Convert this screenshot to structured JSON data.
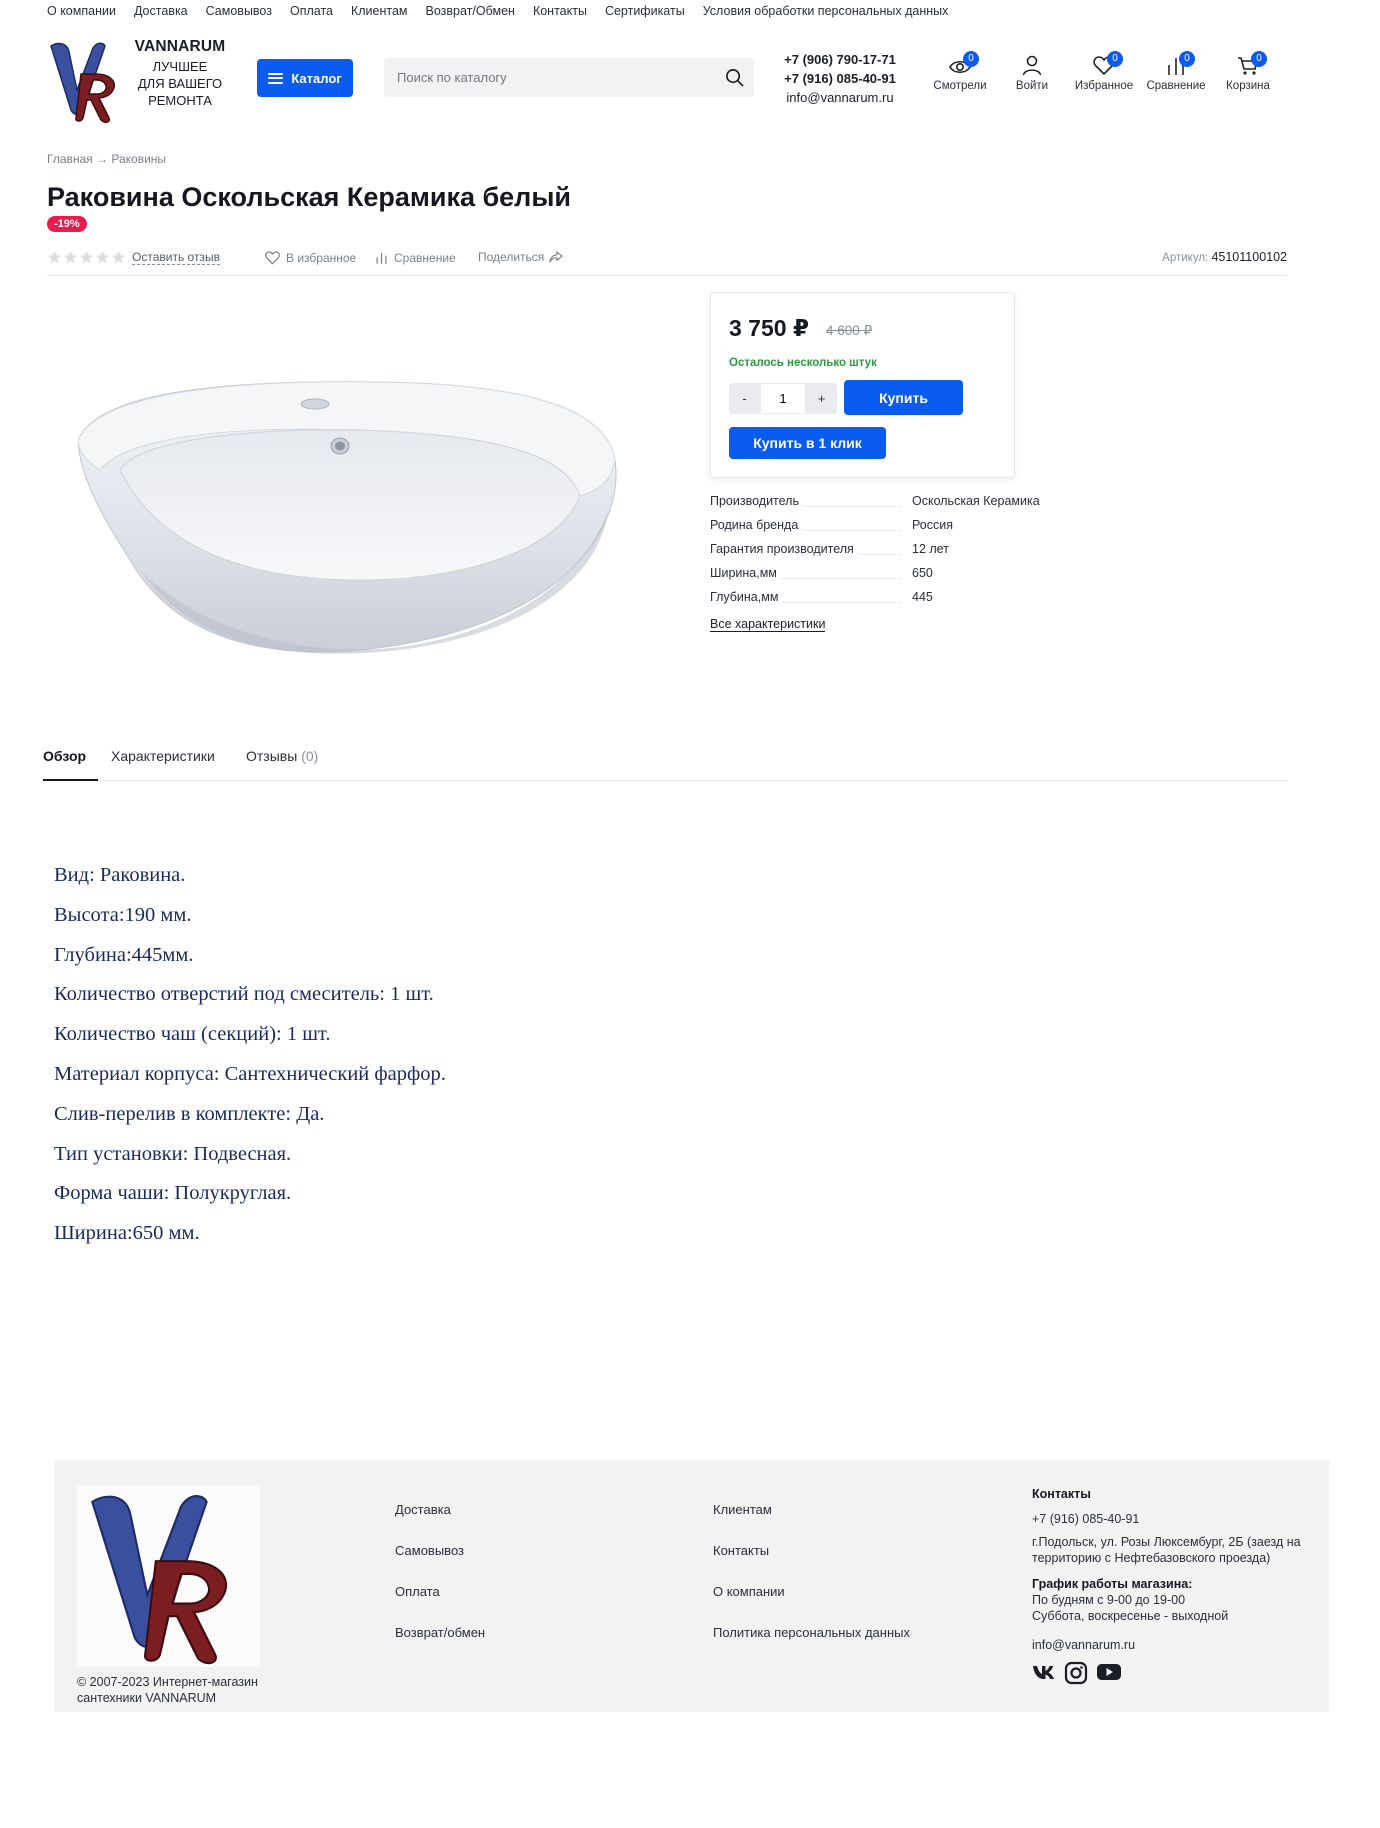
{
  "topnav": [
    "О компании",
    "Доставка",
    "Самовывоз",
    "Оплата",
    "Клиентам",
    "Возврат/Обмен",
    "Контакты",
    "Сертификаты",
    "Условия обработки персональных данных"
  ],
  "brand": {
    "name": "VANNARUM",
    "tagline": [
      "ЛУЧШЕЕ",
      "ДЛЯ ВАШЕГО",
      "РЕМОНТА"
    ],
    "logo_letters": "VR"
  },
  "header": {
    "catalog_label": "Каталог",
    "search_placeholder": "Поиск по каталогу",
    "phone1": "+7 (906) 790-17-71",
    "phone2": "+7 (916) 085-40-91",
    "email": "info@vannarum.ru",
    "icons": [
      {
        "label": "Смотрели",
        "count": "0",
        "icon": "eye-icon"
      },
      {
        "label": "Войти",
        "count": "",
        "icon": "user-icon"
      },
      {
        "label": "Избранное",
        "count": "0",
        "icon": "heart-icon"
      },
      {
        "label": "Сравнение",
        "count": "0",
        "icon": "compare-icon"
      },
      {
        "label": "Корзина",
        "count": "0",
        "icon": "cart-icon"
      }
    ]
  },
  "breadcrumbs": {
    "home": "Главная",
    "arrow": "→",
    "current": "Раковины"
  },
  "product": {
    "title": "Раковина Оскольская Керамика белый",
    "discount": "-19%",
    "rating": 0,
    "review_link": "Оставить отзыв",
    "favorite": "В избранное",
    "compare": "Сравнение",
    "share": "Поделиться",
    "sku_label": "Артикул:",
    "sku": "45101100102",
    "price": "3 750 ₽",
    "old_price": "4 600 ₽",
    "stock": "Осталось несколько штук",
    "qty_minus": "-",
    "qty": "1",
    "qty_plus": "+",
    "buy": "Купить",
    "one_click": "Купить в 1 клик",
    "specs": [
      {
        "k": "Производитель",
        "v": "Оскольская Керамика"
      },
      {
        "k": "Родина бренда",
        "v": "Россия"
      },
      {
        "k": "Гарантия производителя",
        "v": "12 лет"
      },
      {
        "k": "Ширина,мм",
        "v": "650"
      },
      {
        "k": "Глубина,мм",
        "v": "445"
      }
    ],
    "all_specs": "Все характеристики"
  },
  "tabs": [
    {
      "label": "Обзор",
      "count": ""
    },
    {
      "label": "Характеристики",
      "count": ""
    },
    {
      "label": "Отзывы",
      "count": "(0)"
    }
  ],
  "description": [
    "Вид: Раковина.",
    "Высота:190 мм.",
    "Глубина:445мм.",
    "Количество отверстий под смеситель: 1 шт.",
    "Количество чаш (секций): 1 шт.",
    "Материал корпуса: Сантехнический фарфор.",
    "Слив-перелив в комплекте: Да.",
    "Тип установки: Подвесная.",
    "Форма чаши: Полукруглая.",
    "Ширина:650 мм."
  ],
  "footer": {
    "copyright": "© 2007-2023 Интернет-магазин сантехники VANNARUM",
    "col1": [
      "Доставка",
      "Самовывоз",
      "Оплата",
      "Возврат/обмен"
    ],
    "col2": [
      "Клиентам",
      "Контакты",
      "О компании",
      "Политика персональных данных"
    ],
    "contacts_title": "Контакты",
    "phone": "+7 (916) 085-40-91",
    "address": "г.Подольск, ул. Розы Люксембург, 2Б (заезд на территорию с Нефтебазовского проезда)",
    "schedule_title": "График работы магазина:",
    "schedule_weekdays": "По будням с 9-00 до 19-00",
    "schedule_weekend": "Суббота, воскресенье - выходной",
    "email": "info@vannarum.ru",
    "socials": [
      "vk-icon",
      "instagram-icon",
      "youtube-icon"
    ]
  },
  "colors": {
    "accent": "#0a5bf0",
    "sale": "#ec1b4e",
    "stock": "#2e9a3e",
    "logo_blue": "#3a4f9e",
    "logo_red": "#7a1e22"
  }
}
